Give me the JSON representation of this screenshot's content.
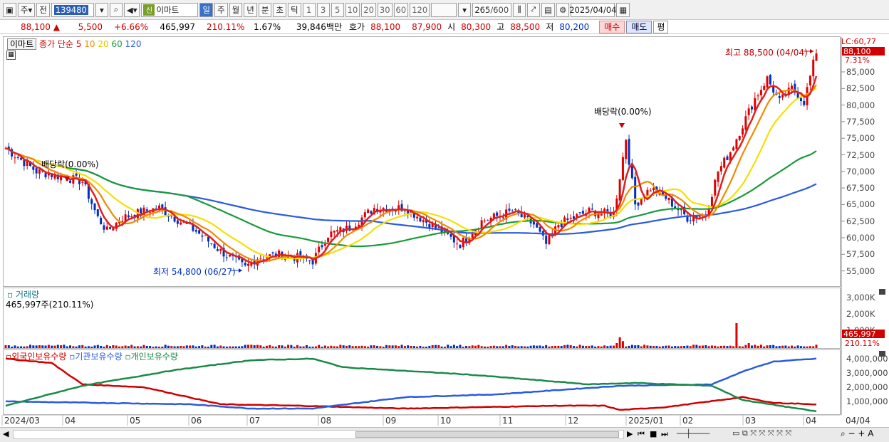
{
  "toolbar": {
    "market": "주",
    "prev": "전",
    "code": "139480",
    "new_label": "신",
    "stock_name": "이마트",
    "periods": [
      "일",
      "주",
      "월",
      "년",
      "분",
      "초",
      "틱"
    ],
    "active_period": "일",
    "intervals": [
      "1",
      "3",
      "5",
      "10",
      "20",
      "30",
      "60",
      "120"
    ],
    "count": "265",
    "count_total": "/600",
    "date": "2025/04/04"
  },
  "quote": {
    "price": "88,100",
    "change": "5,500",
    "change_pct": "+6.66%",
    "volume": "465,997",
    "volume_ratio": "210.11%",
    "turnover": "1.67%",
    "amount": "39,846백만",
    "bid_label": "호가",
    "ask": "88,100",
    "bid": "87,900",
    "open_label": "시",
    "open": "80,300",
    "high_label": "고",
    "high": "88,500",
    "low_label": "저",
    "low": "80,200",
    "buy": "매수",
    "sell": "매도",
    "eval": "평"
  },
  "price_pane": {
    "legend_name": "이마트",
    "legend_ma": "종가 단순 5",
    "ma_periods": [
      "5",
      "10",
      "20",
      "60",
      "120"
    ],
    "lc": "LC:60,77",
    "current": "88,100",
    "current_pct": "7.31%",
    "high_note": "최고 88,500 (04/04)",
    "low_note": "최저 54,800 (06/27)",
    "dividend1": "배당락(0.00%)",
    "dividend2": "배당락(0.00%)",
    "y_ticks": [
      "85,000",
      "82,500",
      "80,000",
      "77,500",
      "75,000",
      "72,500",
      "70,000",
      "67,500",
      "65,000",
      "62,500",
      "60,000",
      "57,500",
      "55,000"
    ]
  },
  "volume_pane": {
    "title": "거래량",
    "value": "465,997주(210.11%)",
    "y_ticks": [
      "3,000K",
      "2,000K",
      "1,000K"
    ],
    "current": "465,997",
    "current_pct": "210.11%"
  },
  "holding_pane": {
    "legend": [
      "외국인보유수량",
      "기관보유수량",
      "개인보유수량"
    ],
    "y_ticks": [
      "4,000,000",
      "3,000,000",
      "2,000,000",
      "1,000,000"
    ]
  },
  "x_axis": [
    "2024/03",
    "04",
    "05",
    "06",
    "07",
    "08",
    "09",
    "10",
    "11",
    "12",
    "2025/01",
    "02",
    "03",
    "04",
    "04/04"
  ],
  "colors": {
    "up": "#e00000",
    "down": "#0030c0",
    "ma5": "#e02020",
    "ma10": "#f08a00",
    "ma20": "#f5e000",
    "ma60": "#1a9a3a",
    "ma120": "#2a5be0"
  }
}
